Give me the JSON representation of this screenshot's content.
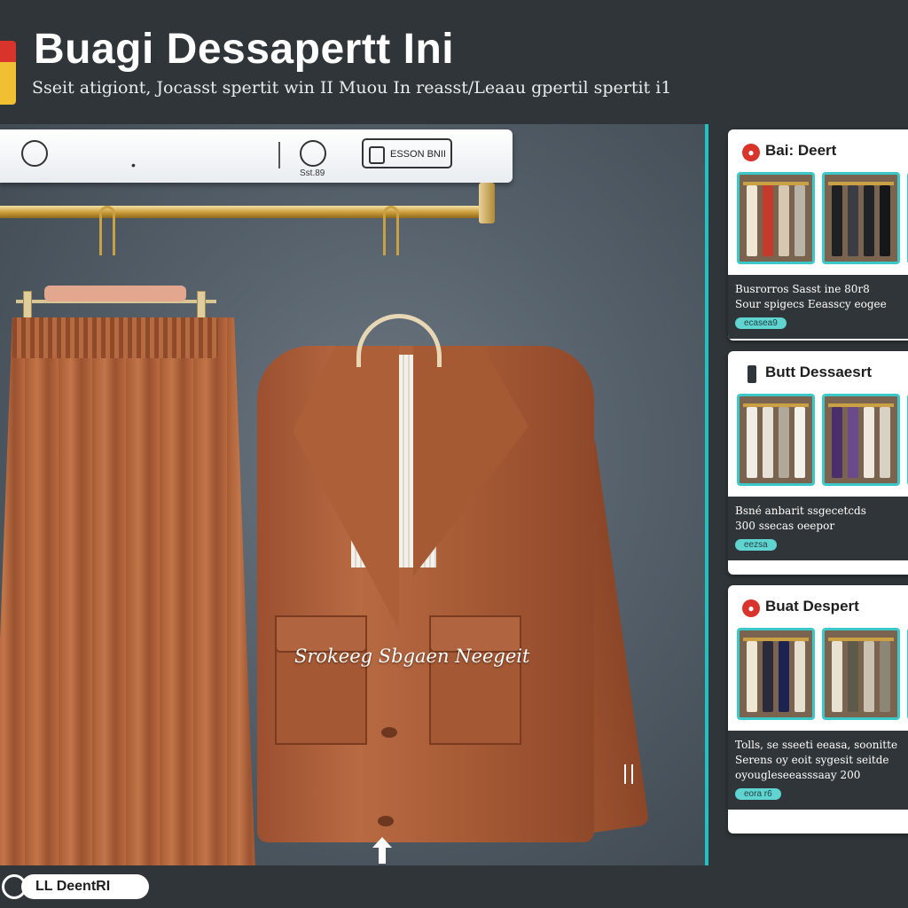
{
  "header": {
    "title": "Buagi Dessapertt Ini",
    "subtitle": "Sseit atigiont, Jocasst spertit win II Muou In reasst/Leaau gpertil spertit i1"
  },
  "toolbar": {
    "left_icon": "circle-icon",
    "center_icon": "circle-icon",
    "center_label": "Sst.89",
    "field_label": "ESSON BNII"
  },
  "scene": {
    "garment_caption": "Srokeeg Sbgaen Neegeit",
    "arrow_icon": "arrow-up-icon"
  },
  "side_panel": {
    "cards": [
      {
        "title": "Bai: Deert",
        "lines": [
          "Busrorros Sasst ine 80r8",
          "Sour spigecs Eeasscy eogee"
        ],
        "badge": "ecasea9",
        "thumb_colors": [
          [
            "#efe6d4",
            "#c43b2b",
            "#d5c7b0",
            "#b9b3a8"
          ],
          [
            "#1e2024",
            "#3a3d44",
            "#202428",
            "#15171a"
          ]
        ]
      },
      {
        "title": "Butt Dessaesrt",
        "lines": [
          "Bsné anbarit ssgecetcds",
          "300 ssecas oeepor"
        ],
        "badge": "eezsa",
        "thumb_colors": [
          [
            "#f1ede6",
            "#e8e2d6",
            "#b0a99a",
            "#f4f0ea"
          ],
          [
            "#4a2f6a",
            "#6b4a8c",
            "#efe9e0",
            "#d8d1c4"
          ]
        ]
      },
      {
        "title": "Buat Despert",
        "lines": [
          "Tolls, se sseeti eeasa, soonitte",
          "Serens oy eoit sygesit seitde",
          "oyougleseeasssaay 200"
        ],
        "badge": "eora r6",
        "thumb_colors": [
          [
            "#efe6d4",
            "#2a2a3a",
            "#1d2350",
            "#e7e0d0"
          ],
          [
            "#e9e2d2",
            "#5e5a4a",
            "#c9c2b0",
            "#8d8676"
          ]
        ]
      }
    ]
  },
  "footer": {
    "chip_label": "LL DeentRI"
  },
  "colors": {
    "background": "#2f3538",
    "accent_teal": "#1fc1c1",
    "brand_red": "#d8342b",
    "brand_yellow": "#f0c032",
    "garment_rust": "#b06a42"
  }
}
